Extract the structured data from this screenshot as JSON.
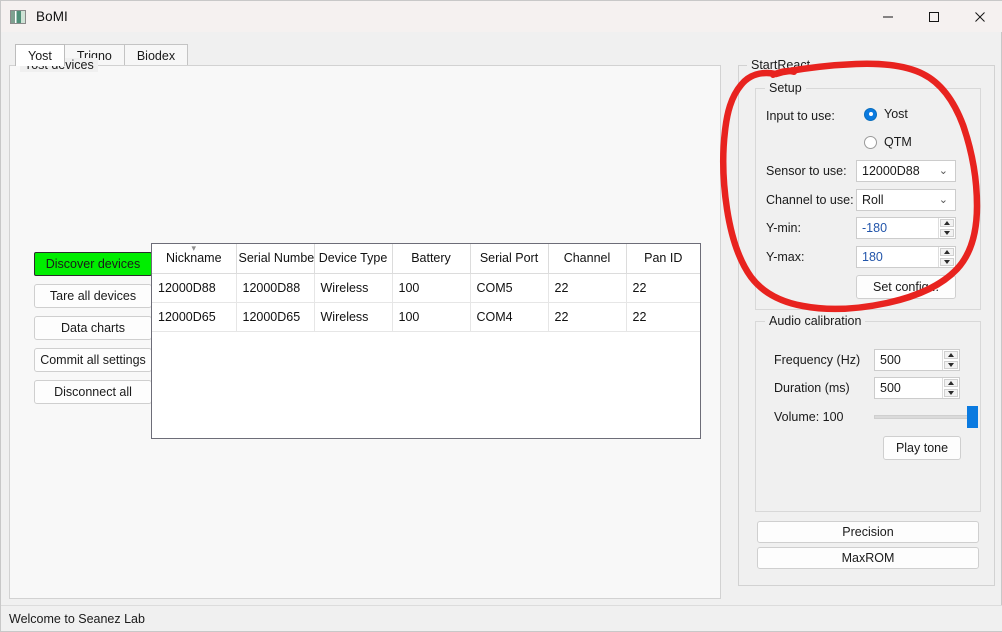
{
  "window": {
    "title": "BoMI",
    "icon": "app-icon",
    "controls": [
      {
        "name": "minimize",
        "glyph": "minimize-icon"
      },
      {
        "name": "maximize",
        "glyph": "maximize-icon"
      },
      {
        "name": "close",
        "glyph": "close-icon"
      }
    ]
  },
  "tabs": [
    {
      "label": "Yost",
      "active": true
    },
    {
      "label": "Trigno",
      "active": false
    },
    {
      "label": "Biodex",
      "active": false
    }
  ],
  "left_panel": {
    "legend": "Yost devices",
    "buttons": [
      {
        "label": "Discover devices",
        "primary": true
      },
      {
        "label": "Tare all devices",
        "primary": false
      },
      {
        "label": "Data charts",
        "primary": false
      },
      {
        "label": "Commit all settings",
        "primary": false
      },
      {
        "label": "Disconnect all",
        "primary": false
      }
    ],
    "table": {
      "sort_indicator": "chevron-down-icon",
      "columns": [
        "Nickname",
        "Serial Number",
        "Device Type",
        "Battery",
        "Serial Port",
        "Channel",
        "Pan ID"
      ],
      "rows": [
        [
          "12000D88",
          "12000D88",
          "Wireless",
          "100",
          "COM5",
          "22",
          "22"
        ],
        [
          "12000D65",
          "12000D65",
          "Wireless",
          "100",
          "COM4",
          "22",
          "22"
        ]
      ]
    }
  },
  "right_panel": {
    "legend": "StartReact",
    "setup": {
      "legend": "Setup",
      "input_label": "Input to use:",
      "input_options": [
        {
          "label": "Yost",
          "selected": true
        },
        {
          "label": "QTM",
          "selected": false
        }
      ],
      "sensor_label": "Sensor to use:",
      "sensor_value": "12000D88",
      "channel_label": "Channel to use:",
      "channel_value": "Roll",
      "ymin_label": "Y-min:",
      "ymin_value": "-180",
      "ymax_label": "Y-max:",
      "ymax_value": "180",
      "set_config_label": "Set config..."
    },
    "audio": {
      "legend": "Audio calibration",
      "frequency_label": "Frequency (Hz)",
      "frequency_value": "500",
      "duration_label": "Duration (ms)",
      "duration_value": "500",
      "volume_label": "Volume: 100",
      "volume_percent": 100,
      "play_tone_label": "Play tone"
    },
    "precision_label": "Precision",
    "maxrom_label": "MaxROM"
  },
  "statusbar": {
    "text": "Welcome to Seanez Lab"
  },
  "annotation": {
    "type": "hand-drawn-ellipse",
    "color": "#e8231f",
    "target": "setup-group"
  },
  "colors": {
    "accent_blue": "#0a7ae0",
    "primary_green": "#00ee00",
    "annotation_red": "#e8231f",
    "window_bg": "#f0f0f0"
  }
}
